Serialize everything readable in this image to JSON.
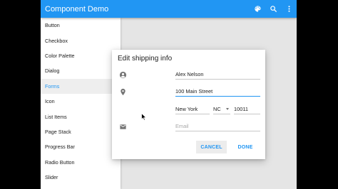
{
  "colors": {
    "primary": "#2196F3",
    "active_nav_text": "#2196F3",
    "dialog_button_text": "#2196F3",
    "icon_gray": "#757575"
  },
  "appbar": {
    "title": "Component Demo",
    "actions": [
      "palette-icon",
      "search-icon",
      "more-vert-icon"
    ]
  },
  "sidebar": {
    "items": [
      {
        "label": "Button"
      },
      {
        "label": "Checkbox"
      },
      {
        "label": "Color Palette"
      },
      {
        "label": "Dialog"
      },
      {
        "label": "Forms",
        "active": true
      },
      {
        "label": "Icon"
      },
      {
        "label": "List Items"
      },
      {
        "label": "Page Stack"
      },
      {
        "label": "Progress Bar"
      },
      {
        "label": "Radio Button"
      },
      {
        "label": "Slider"
      }
    ]
  },
  "dialog": {
    "title": "Edit shipping info",
    "name": {
      "icon": "account-circle-icon",
      "value": "Alex Nelson"
    },
    "address": {
      "icon": "location-pin-icon",
      "value": "100 Main Street"
    },
    "city": {
      "value": "New York"
    },
    "state": {
      "value": "NC"
    },
    "zip": {
      "value": "10011"
    },
    "email": {
      "icon": "email-icon",
      "placeholder": "Email"
    },
    "buttons": {
      "cancel": "CANCEL",
      "done": "DONE"
    }
  }
}
